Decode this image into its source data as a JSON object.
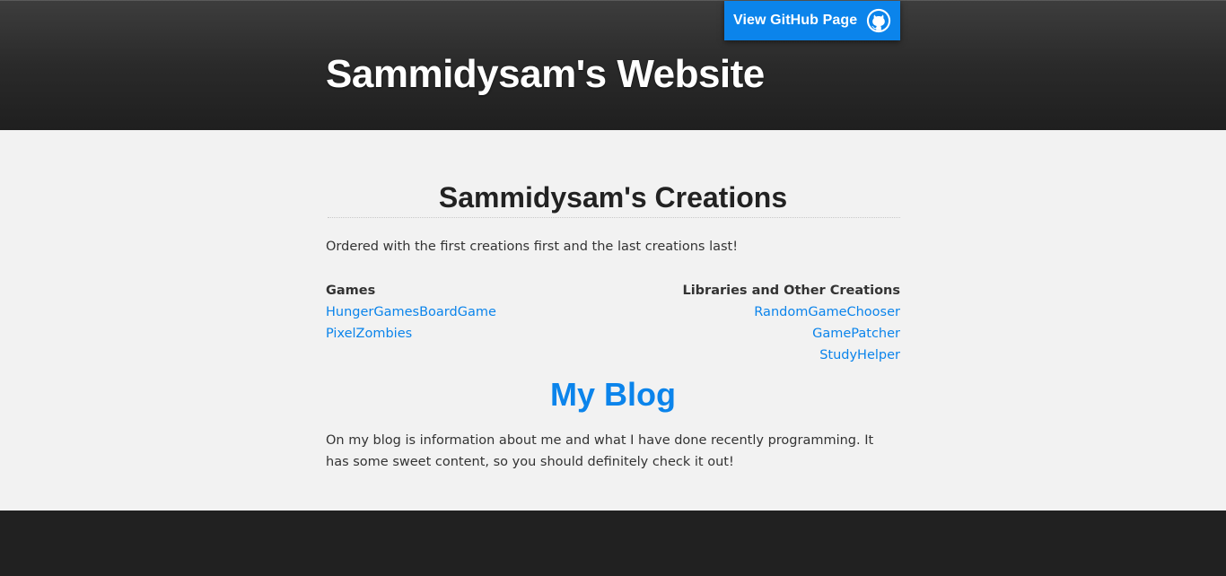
{
  "header": {
    "github_button_label": "View GitHub Page",
    "github_icon": "github-octocat-icon",
    "site_title": "Sammidysam's Website"
  },
  "main": {
    "creations_heading": "Sammidysam's Creations",
    "intro_text": "Ordered with the first creations first and the last creations last!",
    "games": {
      "heading": "Games",
      "items": [
        "HungerGamesBoardGame",
        "PixelZombies"
      ]
    },
    "libraries": {
      "heading": "Libraries and Other Creations",
      "items": [
        "RandomGameChooser",
        "GamePatcher",
        "StudyHelper"
      ]
    },
    "blog_heading": "My Blog",
    "blog_text": "On my blog is information about me and what I have done recently programming. It has some sweet content, so you should definitely check it out!"
  },
  "colors": {
    "accent": "#0b84eb",
    "header_bg": "#2a2a2a",
    "content_bg": "#f2f2f2",
    "footer_bg": "#212121",
    "text": "#333333"
  }
}
